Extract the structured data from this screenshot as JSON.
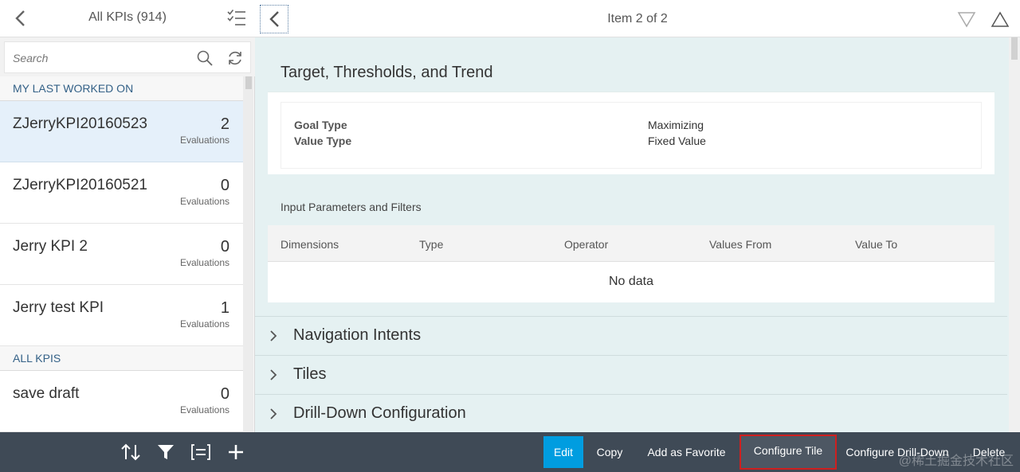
{
  "master": {
    "title": "All KPIs (914)",
    "search_placeholder": "Search",
    "groups": {
      "last_worked": "MY LAST WORKED ON",
      "all": "ALL KPIS"
    },
    "items": [
      {
        "name": "ZJerryKPI20160523",
        "count": "2",
        "unit": "Evaluations",
        "selected": true
      },
      {
        "name": "ZJerryKPI20160521",
        "count": "0",
        "unit": "Evaluations"
      },
      {
        "name": "Jerry KPI 2",
        "count": "0",
        "unit": "Evaluations"
      },
      {
        "name": "Jerry test KPI",
        "count": "1",
        "unit": "Evaluations"
      },
      {
        "name": "save draft",
        "count": "0",
        "unit": "Evaluations"
      }
    ],
    "footer_icons": [
      "sort-icon",
      "filter-icon",
      "group-icon",
      "add-icon"
    ]
  },
  "detail": {
    "title": "Item 2 of 2",
    "section_title": "Target, Thresholds, and Trend",
    "fields": [
      {
        "label": "Goal Type",
        "value": "Maximizing"
      },
      {
        "label": "Value Type",
        "value": "Fixed Value"
      }
    ],
    "input_params_title": "Input Parameters and Filters",
    "columns": [
      "Dimensions",
      "Type",
      "Operator",
      "Values From",
      "Value To"
    ],
    "no_data": "No data",
    "accordions": [
      "Navigation Intents",
      "Tiles",
      "Drill-Down Configuration"
    ],
    "footer": {
      "edit": "Edit",
      "copy": "Copy",
      "favorite": "Add as Favorite",
      "configure_tile": "Configure Tile",
      "configure_drilldown": "Configure Drill-Down",
      "delete": "Delete"
    },
    "watermark": "@稀土掘金技术社区"
  },
  "colors": {
    "shell_footer": "#3f4a56",
    "primary_button": "#009de0",
    "highlight_border": "#cf1f1f",
    "detail_background": "#e5f1f2",
    "selected_item": "#e5f0fa",
    "group_text": "#346187"
  }
}
